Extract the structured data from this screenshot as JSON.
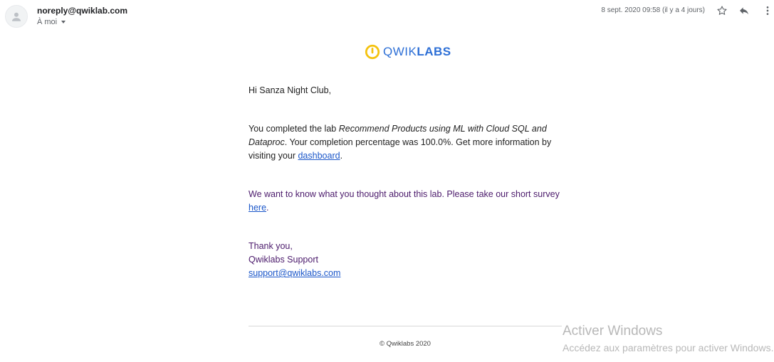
{
  "header": {
    "sender": "noreply@qwiklab.com",
    "recipient": "À moi",
    "date": "8 sept. 2020 09:58 (il y a 4 jours)",
    "icons": [
      "avatar-icon",
      "star-icon",
      "reply-icon",
      "more-icon"
    ]
  },
  "logo": {
    "part1": "QWIK",
    "part2": "LABS",
    "color": "#2d6fd6",
    "accent": "#f4c20d"
  },
  "body": {
    "greeting": "Hi Sanza Night Club,",
    "p1_before": "You completed the lab ",
    "p1_lab": "Recommend Products using ML with Cloud SQL and Dataproc",
    "p1_after": ". Your completion percentage was 100.0%. Get more information by visiting your ",
    "p1_link": "dashboard",
    "p1_end": ".",
    "p2_before": "We want to know what you thought about this lab. Please take our short survey ",
    "p2_link": "here",
    "p2_end": ".",
    "sign_thanks": "Thank you,",
    "sign_team": "Qwiklabs Support",
    "sign_email": "support@qwiklabs.com"
  },
  "footer": {
    "copyright": "© Qwiklabs 2020"
  },
  "watermark": {
    "title": "Activer Windows",
    "subtitle": "Accédez aux paramètres pour activer Windows."
  }
}
